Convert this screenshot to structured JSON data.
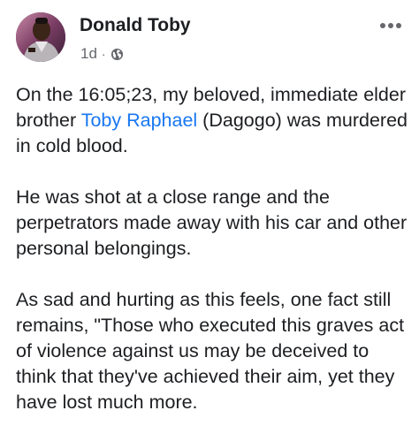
{
  "post": {
    "author": {
      "name": "Donald Toby",
      "avatar_icon": "profile-photo-icon"
    },
    "meta": {
      "time": "1d",
      "separator": "·",
      "audience_icon": "globe-icon"
    },
    "more_icon": "more-options-icon",
    "body": {
      "p1_before": "On the 16:05;23, my beloved, immediate elder brother ",
      "p1_mention": "Toby Raphael",
      "p1_after": " (Dagogo) was murdered in cold blood.",
      "p2": "He was shot at a close range and the perpetrators made away with his car and other personal belongings.",
      "p3": "As sad and hurting as this feels, one fact still remains, \"Those who executed this graves act of violence against us may be deceived to think that they've achieved their aim, yet they have lost much more."
    }
  },
  "colors": {
    "text": "#1c1e21",
    "secondary": "#65676b",
    "link": "#1877f2"
  }
}
